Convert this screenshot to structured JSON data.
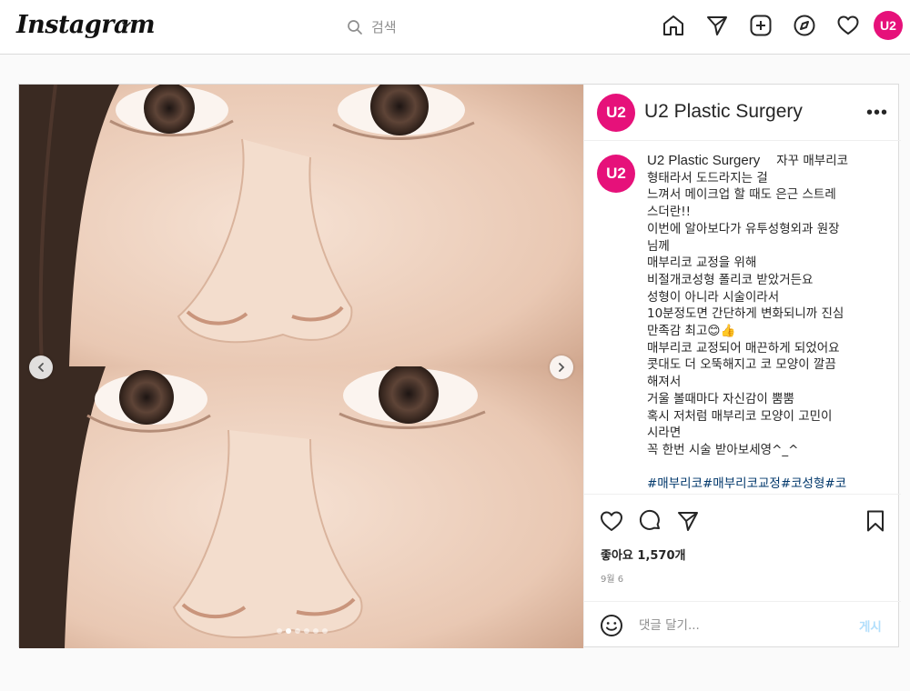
{
  "nav": {
    "logo": "Instagram",
    "search_placeholder": "검색",
    "avatar_text": "U2",
    "icons": [
      "home-icon",
      "direct-icon",
      "new-post-icon",
      "explore-icon",
      "activity-icon"
    ]
  },
  "post": {
    "username": "U2 Plastic Surgery",
    "avatar_text": "U2",
    "brand_color": "#e6117a",
    "more_label": "•••",
    "caption_lines": [
      "자꾸 매부리코",
      "형태라서 도드라지는 걸",
      "느껴서 메이크업 할 때도 은근 스트레",
      "스더란!!",
      "이번에 알아보다가 유투성형외과 원장",
      "님께",
      "매부리코 교정을 위해",
      "비절개코성형 폴리코 받았거든요",
      "성형이 아니라 시술이라서",
      "10분정도면 간단하게 변화되니까 진심",
      "만족감 최고😊👍",
      "매부리코 교정되어 매끈하게 되었어요",
      "콧대도 더 오뚝해지고 코 모양이 깔끔",
      "해져서",
      "거울 볼때마다 자신감이 뿜뿜",
      "혹시 저처럼 매부리코 모양이 고민이",
      "시라면",
      "꼭 한번 시술 받아보세영^_^",
      ""
    ],
    "hashtags": "#매부리코#매부리코교정#코성형#코",
    "likes": "좋아요 1,570개",
    "date": "9월 6",
    "comment_placeholder": "댓글 달기...",
    "post_button": "게시",
    "carousel": {
      "slide_count": 6,
      "active_index": 1
    }
  }
}
